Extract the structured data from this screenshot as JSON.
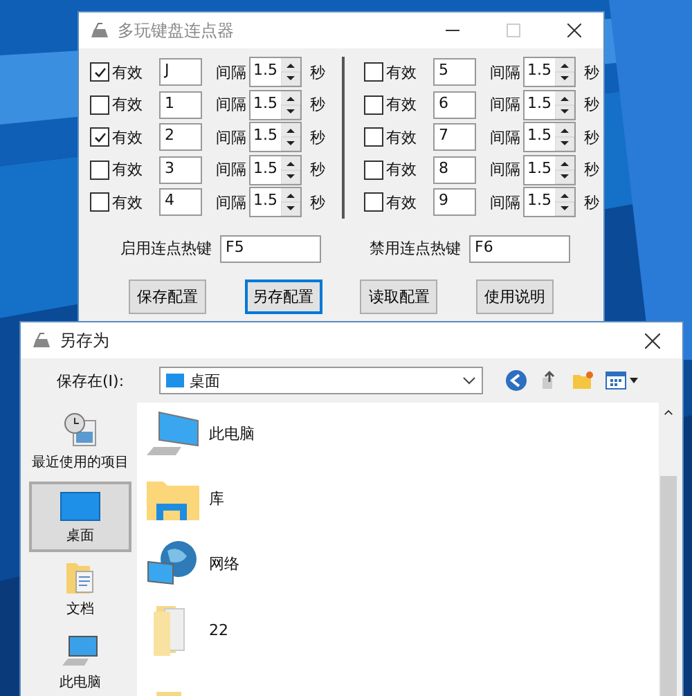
{
  "main_window": {
    "title": "多玩键盘连点器",
    "left_rows": [
      {
        "checked": true,
        "label": "有效",
        "key": "J",
        "interval_label": "间隔",
        "interval": "1.5",
        "unit": "秒"
      },
      {
        "checked": false,
        "label": "有效",
        "key": "1",
        "interval_label": "间隔",
        "interval": "1.5",
        "unit": "秒"
      },
      {
        "checked": true,
        "label": "有效",
        "key": "2",
        "interval_label": "间隔",
        "interval": "1.5",
        "unit": "秒"
      },
      {
        "checked": false,
        "label": "有效",
        "key": "3",
        "interval_label": "间隔",
        "interval": "1.5",
        "unit": "秒"
      },
      {
        "checked": false,
        "label": "有效",
        "key": "4",
        "interval_label": "间隔",
        "interval": "1.5",
        "unit": "秒"
      }
    ],
    "right_rows": [
      {
        "checked": false,
        "label": "有效",
        "key": "5",
        "interval_label": "间隔",
        "interval": "1.5",
        "unit": "秒"
      },
      {
        "checked": false,
        "label": "有效",
        "key": "6",
        "interval_label": "间隔",
        "interval": "1.5",
        "unit": "秒"
      },
      {
        "checked": false,
        "label": "有效",
        "key": "7",
        "interval_label": "间隔",
        "interval": "1.5",
        "unit": "秒"
      },
      {
        "checked": false,
        "label": "有效",
        "key": "8",
        "interval_label": "间隔",
        "interval": "1.5",
        "unit": "秒"
      },
      {
        "checked": false,
        "label": "有效",
        "key": "9",
        "interval_label": "间隔",
        "interval": "1.5",
        "unit": "秒"
      }
    ],
    "hotkeys": [
      {
        "label": "启用连点热键",
        "value": "F5"
      },
      {
        "label": "禁用连点热键",
        "value": "F6"
      }
    ],
    "buttons": [
      {
        "label": "保存配置",
        "selected": false
      },
      {
        "label": "另存配置",
        "selected": true
      },
      {
        "label": "读取配置",
        "selected": false
      },
      {
        "label": "使用说明",
        "selected": false
      }
    ]
  },
  "save_dialog": {
    "title": "另存为",
    "location_label": "保存在(I):",
    "location": "桌面",
    "places": [
      {
        "label": "最近使用的项目",
        "kind": "recent",
        "selected": false
      },
      {
        "label": "桌面",
        "kind": "desktop",
        "selected": true
      },
      {
        "label": "文档",
        "kind": "documents",
        "selected": false
      },
      {
        "label": "此电脑",
        "kind": "computer",
        "selected": false
      }
    ],
    "files": [
      {
        "name": "此电脑",
        "kind": "computer"
      },
      {
        "name": "库",
        "kind": "library"
      },
      {
        "name": "网络",
        "kind": "network"
      },
      {
        "name": "22",
        "kind": "folder"
      },
      {
        "kind": "media-folder"
      }
    ]
  }
}
